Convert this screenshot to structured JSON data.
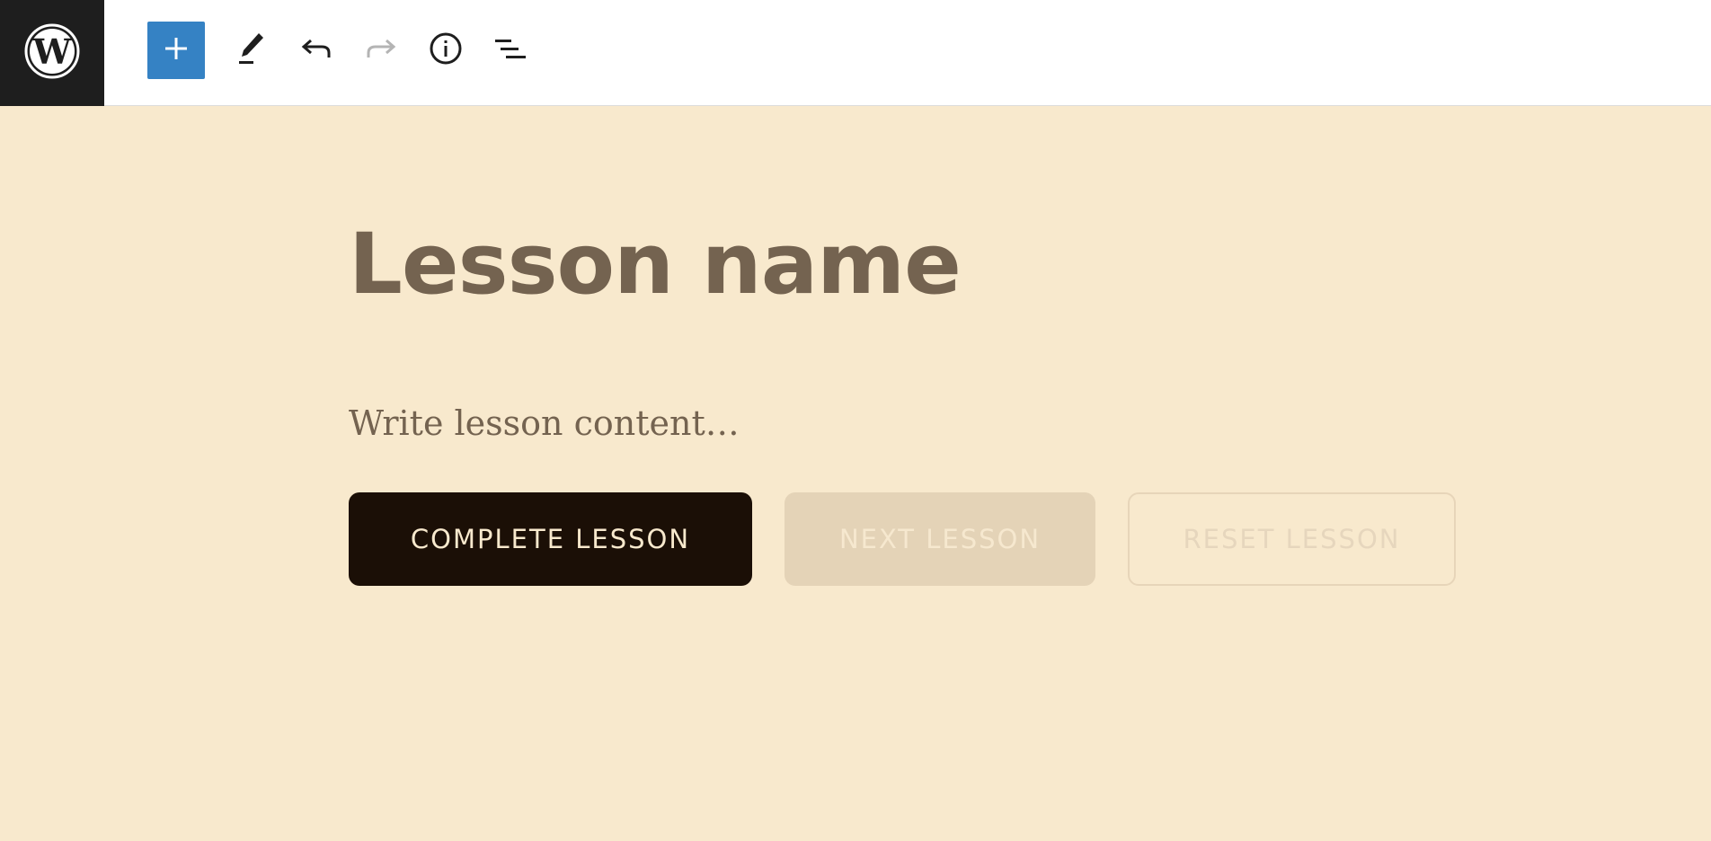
{
  "toolbar": {
    "logo_icon": "wordpress-logo-icon",
    "add_icon": "plus-icon",
    "edit_icon": "pencil-icon",
    "undo_icon": "undo-icon",
    "redo_icon": "redo-icon",
    "info_icon": "info-icon",
    "list_icon": "list-view-icon",
    "add_button_color": "#3582c4"
  },
  "lesson": {
    "title": "Lesson name",
    "content_placeholder": "Write lesson content…"
  },
  "buttons": {
    "complete_label": "COMPLETE LESSON",
    "next_label": "NEXT LESSON",
    "reset_label": "RESET LESSON"
  },
  "colors": {
    "canvas_background": "#f8e9cd",
    "text": "#746350",
    "complete_button": "#1b0f06"
  }
}
